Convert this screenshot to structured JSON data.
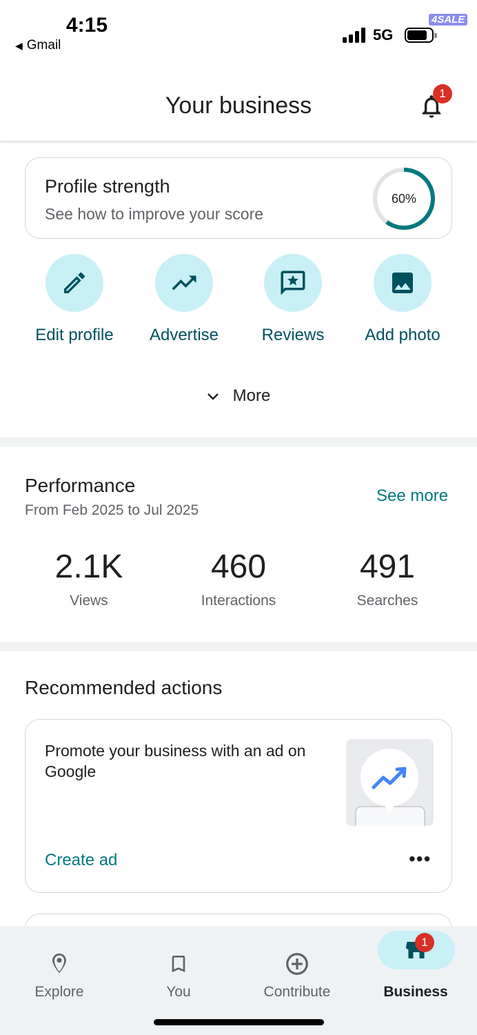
{
  "status_bar": {
    "time": "4:15",
    "back_app": "Gmail",
    "network": "5G",
    "watermark": "4SALE"
  },
  "header": {
    "title": "Your business",
    "notification_count": "1"
  },
  "profile_strength": {
    "title": "Profile strength",
    "subtitle": "See how to improve your score",
    "percent_label": "60%",
    "percent": 60
  },
  "quick_actions": [
    {
      "label": "Edit profile",
      "icon": "pencil-icon"
    },
    {
      "label": "Advertise",
      "icon": "trending-up-icon"
    },
    {
      "label": "Reviews",
      "icon": "review-star-icon"
    },
    {
      "label": "Add photo",
      "icon": "image-icon"
    }
  ],
  "more_label": "More",
  "performance": {
    "title": "Performance",
    "date_range": "From Feb 2025 to Jul 2025",
    "see_more": "See more",
    "stats": [
      {
        "value": "2.1K",
        "label": "Views"
      },
      {
        "value": "460",
        "label": "Interactions"
      },
      {
        "value": "491",
        "label": "Searches"
      }
    ]
  },
  "recommended": {
    "title": "Recommended actions",
    "card": {
      "text": "Promote your business with an ad on Google",
      "action": "Create ad",
      "image_icon": "trending-up-icon"
    }
  },
  "bottom_nav": {
    "items": [
      {
        "label": "Explore",
        "icon": "location-pin-icon"
      },
      {
        "label": "You",
        "icon": "bookmark-icon"
      },
      {
        "label": "Contribute",
        "icon": "add-circle-icon"
      },
      {
        "label": "Business",
        "icon": "storefront-icon"
      }
    ],
    "active": "Business",
    "business_badge": "1"
  },
  "colors": {
    "accent_teal": "#00797f",
    "icon_bg": "#c8f0f6",
    "badge_red": "#d93025"
  }
}
